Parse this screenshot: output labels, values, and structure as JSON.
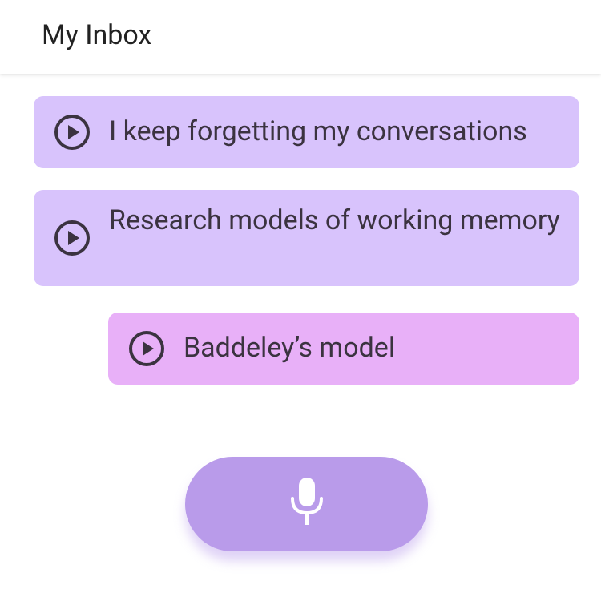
{
  "header": {
    "title": "My Inbox"
  },
  "messages": [
    {
      "text": "I keep forgetting my conversations",
      "icon": "play-circle-icon",
      "level": 0
    },
    {
      "text": "Research models of working memory",
      "icon": "play-circle-icon",
      "level": 0
    },
    {
      "text": "Baddeley’s model",
      "icon": "play-circle-icon",
      "level": 1
    }
  ],
  "record_button": {
    "icon": "microphone-icon"
  },
  "colors": {
    "message_root": "#d8c3fc",
    "message_reply": "#e8b0f8",
    "record_button": "#b99bea",
    "icon": "#3b3340",
    "text": "#3b3340"
  }
}
